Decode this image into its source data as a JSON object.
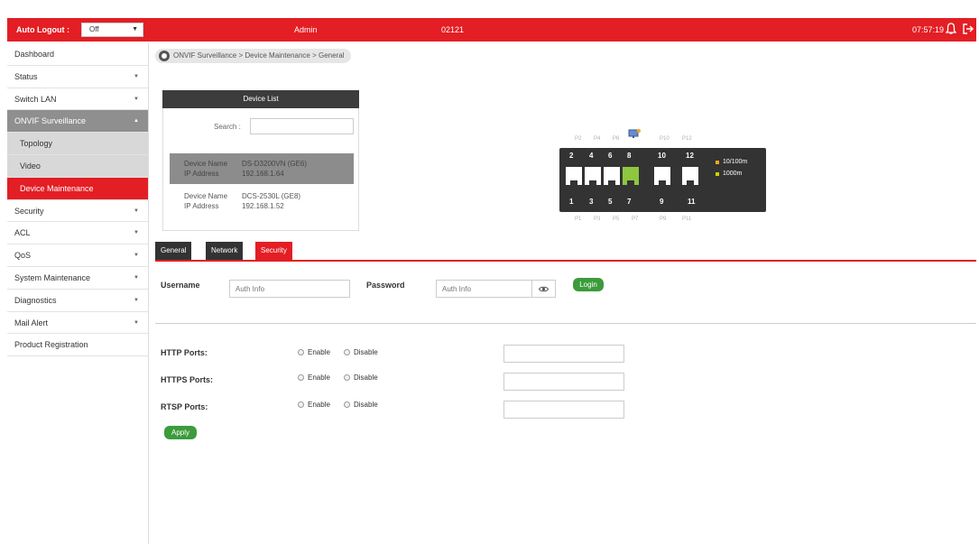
{
  "topbar": {
    "auto_logout_label": "Auto Logout :",
    "auto_logout_value": "Off",
    "user": "Admin",
    "serial": "02121",
    "clock": "07:57:19"
  },
  "sidebar": {
    "items": [
      {
        "label": "Dashboard"
      },
      {
        "label": "Status"
      },
      {
        "label": "Switch LAN"
      },
      {
        "label": "ONVIF Surveillance"
      },
      {
        "label": "Topology"
      },
      {
        "label": "Video"
      },
      {
        "label": "Device Maintenance"
      },
      {
        "label": "Security"
      },
      {
        "label": "ACL"
      },
      {
        "label": "QoS"
      },
      {
        "label": "System Maintenance"
      },
      {
        "label": "Diagnostics"
      },
      {
        "label": "Mail Alert"
      },
      {
        "label": "Product Registration"
      }
    ]
  },
  "breadcrumb": "ONVIF Surveillance > Device Maintenance > General",
  "device_list": {
    "title": "Device List",
    "search_label": "Search :",
    "devices": [
      {
        "name_key": "Device Name",
        "name": "DS-D3200VN (GE6)",
        "ip_key": "IP Address",
        "ip": "192.168.1.64"
      },
      {
        "name_key": "Device Name",
        "name": "DCS-2530L (GE8)",
        "ip_key": "IP Address",
        "ip": "192.168.1.52"
      }
    ]
  },
  "switch": {
    "top_labels": [
      "P2",
      "P4",
      "P6",
      "P8",
      "P10",
      "P12"
    ],
    "bottom_labels": [
      "P1",
      "P3",
      "P5",
      "P7",
      "P9",
      "P11"
    ],
    "top_numbers": [
      "2",
      "4",
      "6",
      "8",
      "10",
      "12"
    ],
    "bottom_numbers": [
      "1",
      "3",
      "5",
      "7",
      "9",
      "11"
    ],
    "legend": [
      {
        "label": "10/100m",
        "color": "#f5a623"
      },
      {
        "label": "1000m",
        "color": "#c8d400"
      }
    ],
    "active_port_color": "#8ec63f"
  },
  "tabs": [
    {
      "label": "General"
    },
    {
      "label": "Network"
    },
    {
      "label": "Security"
    }
  ],
  "auth": {
    "username_label": "Username",
    "username_placeholder": "Auth Info",
    "password_label": "Password",
    "password_placeholder": "Auth Info",
    "login_label": "Login"
  },
  "ports": [
    {
      "label": "HTTP Ports:",
      "enable": "Enable",
      "disable": "Disable"
    },
    {
      "label": "HTTPS Ports:",
      "enable": "Enable",
      "disable": "Disable"
    },
    {
      "label": "RTSP Ports:",
      "enable": "Enable",
      "disable": "Disable"
    }
  ],
  "apply_label": "Apply",
  "colors": {
    "brand": "#e31e24",
    "green": "#3c9b3c",
    "dark": "#333333"
  }
}
